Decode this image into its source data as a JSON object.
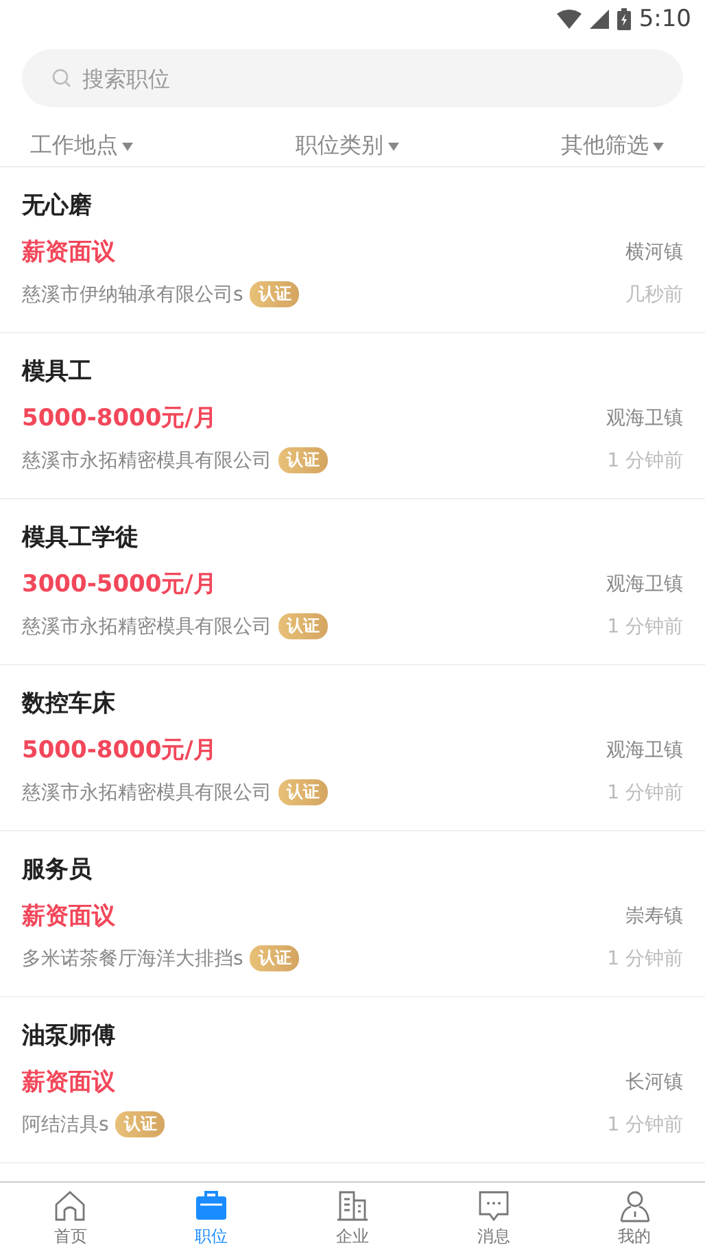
{
  "status_bar": {
    "time": "5:10"
  },
  "search": {
    "placeholder": "搜索职位"
  },
  "filters": [
    {
      "label": "工作地点"
    },
    {
      "label": "职位类别"
    },
    {
      "label": "其他筛选"
    }
  ],
  "jobs": [
    {
      "title": "无心磨",
      "salary": "薪资面议",
      "location": "横河镇",
      "company": "慈溪市伊纳轴承有限公司s",
      "badge": "认证",
      "time": "几秒前"
    },
    {
      "title": "模具工",
      "salary": "5000-8000元/月",
      "location": "观海卫镇",
      "company": "慈溪市永拓精密模具有限公司",
      "badge": "认证",
      "time": "1 分钟前"
    },
    {
      "title": "模具工学徒",
      "salary": "3000-5000元/月",
      "location": "观海卫镇",
      "company": "慈溪市永拓精密模具有限公司",
      "badge": "认证",
      "time": "1 分钟前"
    },
    {
      "title": "数控车床",
      "salary": "5000-8000元/月",
      "location": "观海卫镇",
      "company": "慈溪市永拓精密模具有限公司",
      "badge": "认证",
      "time": "1 分钟前"
    },
    {
      "title": "服务员",
      "salary": "薪资面议",
      "location": "崇寿镇",
      "company": "多米诺茶餐厅海洋大排挡s",
      "badge": "认证",
      "time": "1 分钟前"
    },
    {
      "title": "油泵师傅",
      "salary": "薪资面议",
      "location": "长河镇",
      "company": "阿结洁具s",
      "badge": "认证",
      "time": "1 分钟前"
    }
  ],
  "nav": [
    {
      "kind": "home",
      "label": "首页",
      "selected": false
    },
    {
      "kind": "briefcase",
      "label": "职位",
      "selected": true
    },
    {
      "kind": "building",
      "label": "企业",
      "selected": false
    },
    {
      "kind": "chat",
      "label": "消息",
      "selected": false
    },
    {
      "kind": "person",
      "label": "我的",
      "selected": false
    }
  ]
}
